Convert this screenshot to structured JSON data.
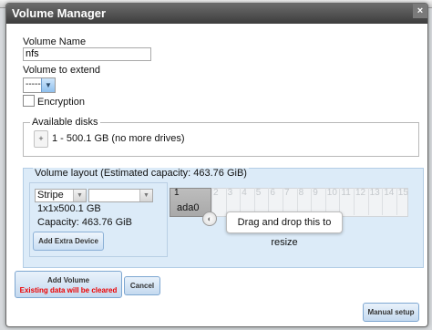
{
  "dialog": {
    "title": "Volume Manager",
    "close_glyph": "×",
    "volume_name_label": "Volume Name",
    "volume_name_value": "nfs",
    "volume_extend_label": "Volume to extend",
    "volume_extend_value": "-----",
    "encryption_label": "Encryption",
    "available_disks_legend": "Available disks",
    "disk_add_glyph": "+",
    "disk_entry": "1 - 500.1 GB (no more drives)",
    "layout_legend": "Volume layout (Estimated capacity: 463.76 GiB)",
    "layout_type": "Stripe",
    "layout_secondary": "",
    "layout_dims": "1x1x500.1 GB",
    "layout_capacity": "Capacity: 463.76 GiB",
    "add_extra_label": "Add Extra Device",
    "grid_numbers": [
      "2",
      "3",
      "4",
      "5",
      "6",
      "7",
      "8",
      "9",
      "10",
      "11",
      "12",
      "13",
      "14",
      "15"
    ],
    "drive_number": "1",
    "drive_name": "ada0",
    "resize_tooltip": "Drag and drop this to resize",
    "add_volume_label": "Add Volume",
    "add_volume_warning": "Existing data will be cleared",
    "cancel_label": "Cancel",
    "manual_setup_label": "Manual setup"
  },
  "colors": {
    "title_bar": "#4f4f4f",
    "layout_bg": "#dcebf8",
    "warning": "#ee0000",
    "button_border": "#7ea7d1"
  },
  "icons": {
    "close": "close-icon",
    "dropdown": "chevron-down-icon",
    "resize": "resize-handle-icon"
  }
}
